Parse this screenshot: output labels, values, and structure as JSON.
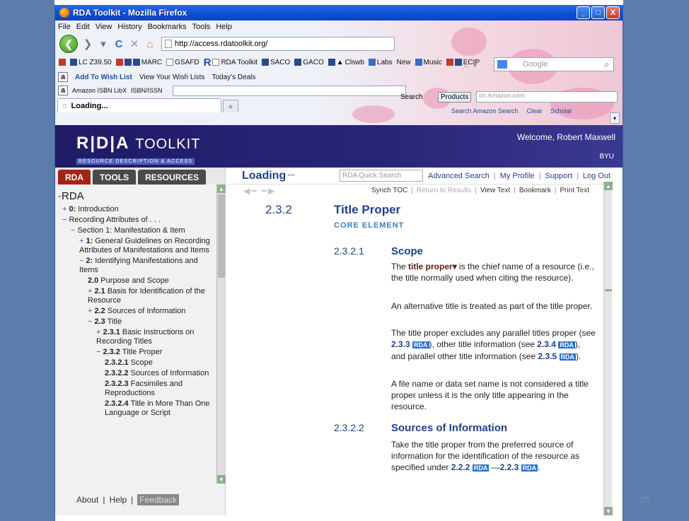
{
  "slide_number": "25",
  "window": {
    "title": "RDA Toolkit - Mozilla Firefox",
    "controls": [
      "_",
      "□",
      "X"
    ]
  },
  "menu": [
    "File",
    "Edit",
    "View",
    "History",
    "Bookmarks",
    "Tools",
    "Help"
  ],
  "nav": {
    "url": "http://access.rdatoolkit.org/",
    "search_placeholder": "Google"
  },
  "bookmarks": [
    "LC Z39.50",
    "MARC",
    "GSAFD",
    "RDA Toolkit",
    "SACO",
    "GACO",
    "Clswb",
    "Labs",
    "New",
    "Music",
    "ECIP"
  ],
  "amazon_bar": {
    "add_wish": "Add To Wish List",
    "view_wish": "View Your Wish Lists",
    "deals": "Today's Deals",
    "search_label": "Search",
    "products": "Products",
    "amazon_placeholder": "on Amazon.com"
  },
  "libx_bar": {
    "libx": "Amazon ISBN LibX",
    "isbn": "ISBN/ISSN",
    "search_amazon": "Search Amazon Search",
    "clear": "Clear",
    "scholar": "Scholar"
  },
  "tab": {
    "label": "Loading...",
    "new_tab": "+"
  },
  "header": {
    "logo_rda": "R|D|A",
    "logo_toolkit": "TOOLKIT",
    "logo_sub": "RESOURCE DESCRIPTION & ACCESS",
    "welcome": "Welcome, Robert Maxwell",
    "org": "BYU"
  },
  "left": {
    "tabs": [
      "RDA",
      "TOOLS",
      "RESOURCES"
    ],
    "root": "RDA",
    "toc": [
      {
        "mark": "+",
        "num": "0:",
        "text": "Introduction",
        "indent": 0
      },
      {
        "mark": "−",
        "num": "",
        "text": "Recording Attributes of . . .",
        "indent": 0
      },
      {
        "mark": "−",
        "num": "",
        "text": "Section 1: Manifestation & Item",
        "indent": 1
      },
      {
        "mark": "+",
        "num": "1:",
        "text": "General Guidelines on Recording Attributes of Manifestations and Items",
        "indent": 2
      },
      {
        "mark": "−",
        "num": "2:",
        "text": "Identifying Manifestations and Items",
        "indent": 2
      },
      {
        "mark": "",
        "num": "2.0",
        "text": "Purpose and Scope",
        "indent": 3
      },
      {
        "mark": "+",
        "num": "2.1",
        "text": "Basis for Identification of the Resource",
        "indent": 3
      },
      {
        "mark": "+",
        "num": "2.2",
        "text": "Sources of Information",
        "indent": 3
      },
      {
        "mark": "−",
        "num": "2.3",
        "text": "Title",
        "indent": 3
      },
      {
        "mark": "+",
        "num": "2.3.1",
        "text": "Basic Instructions on Recording Titles",
        "indent": 4
      },
      {
        "mark": "−",
        "num": "2.3.2",
        "text": "Title Proper",
        "indent": 4
      },
      {
        "mark": "",
        "num": "2.3.2.1",
        "text": "Scope",
        "indent": 5
      },
      {
        "mark": "",
        "num": "2.3.2.2",
        "text": "Sources of Information",
        "indent": 5
      },
      {
        "mark": "",
        "num": "2.3.2.3",
        "text": "Facsimiles and Reproductions",
        "indent": 5
      },
      {
        "mark": "",
        "num": "2.3.2.4",
        "text": "Title in More Than One Language or Script",
        "indent": 5
      }
    ],
    "footer": {
      "about": "About",
      "help": "Help",
      "feedback": "Feedback"
    }
  },
  "right": {
    "loading": "Loading",
    "quick_search_placeholder": "RDA Quick Search",
    "links": [
      "Advanced Search",
      "My Profile",
      "Support",
      "Log Out"
    ],
    "synch": [
      "Synch TOC",
      "Return to Results",
      "View Text",
      "Bookmark",
      "Print Text"
    ],
    "doc": {
      "h2_num": "2.3.2",
      "h2_title": "Title Proper",
      "core": "CORE ELEMENT",
      "s1_num": "2.3.2.1",
      "s1_title": "Scope",
      "p1_pre": "The ",
      "p1_term": "title proper▾",
      "p1_post": " is the chief name of a resource (i.e., the title normally used when citing the resource).",
      "p2": "An alternative title is treated as part of the title proper.",
      "p3_a": "The title proper excludes any parallel titles proper (see ",
      "p3_r1": "2.3.3",
      "p3_b": "), other title information (see ",
      "p3_r2": "2.3.4",
      "p3_c": "), and parallel other title information (see ",
      "p3_r3": "2.3.5",
      "p3_d": ").",
      "p4": "A file name or data set name is not considered a title proper unless it is the only title appearing in the resource.",
      "s2_num": "2.3.2.2",
      "s2_title": "Sources of Information",
      "p5_a": "Take the title proper from the preferred source of information for the identification of the resource as specified under ",
      "p5_r1": "2.2.2",
      "p5_b": "—",
      "p5_r2": "2.2.3",
      "p5_c": ".",
      "badge": "RDA"
    }
  }
}
